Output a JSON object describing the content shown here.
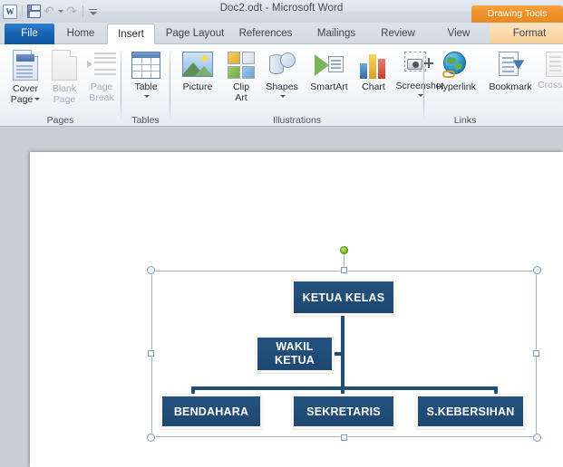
{
  "window": {
    "title": "Doc2.odt  -  Microsoft Word",
    "contextual_tab_label": "Drawing Tools"
  },
  "quick_access": {
    "items": [
      {
        "name": "word-logo-icon",
        "label": "W"
      },
      {
        "name": "save-icon",
        "label": "Save"
      },
      {
        "name": "undo-icon",
        "label": "Undo"
      },
      {
        "name": "redo-icon",
        "label": "Redo"
      },
      {
        "name": "customize-quick-access-icon",
        "label": "Customize Quick Access Toolbar"
      }
    ]
  },
  "tabs": [
    {
      "label": "File",
      "active": false,
      "kind": "file"
    },
    {
      "label": "Home",
      "active": false
    },
    {
      "label": "Insert",
      "active": true
    },
    {
      "label": "Page Layout",
      "active": false
    },
    {
      "label": "References",
      "active": false
    },
    {
      "label": "Mailings",
      "active": false
    },
    {
      "label": "Review",
      "active": false
    },
    {
      "label": "View",
      "active": false
    },
    {
      "label": "Format",
      "active": false,
      "kind": "contextual"
    }
  ],
  "ribbon": {
    "groups": [
      {
        "label": "Pages",
        "buttons": [
          {
            "label_line1": "Cover",
            "label_line2": "Page",
            "icon": "cover-page-icon",
            "dropdown": true,
            "disabled": false
          },
          {
            "label_line1": "Blank",
            "label_line2": "Page",
            "icon": "blank-page-icon",
            "dropdown": false,
            "disabled": true
          },
          {
            "label_line1": "Page",
            "label_line2": "Break",
            "icon": "page-break-icon",
            "dropdown": false,
            "disabled": true
          }
        ]
      },
      {
        "label": "Tables",
        "buttons": [
          {
            "label_line1": "Table",
            "label_line2": "",
            "icon": "table-icon",
            "dropdown": true,
            "disabled": false
          }
        ]
      },
      {
        "label": "Illustrations",
        "buttons": [
          {
            "label_line1": "Picture",
            "label_line2": "",
            "icon": "picture-icon",
            "dropdown": false,
            "disabled": false
          },
          {
            "label_line1": "Clip",
            "label_line2": "Art",
            "icon": "clip-art-icon",
            "dropdown": false,
            "disabled": false
          },
          {
            "label_line1": "Shapes",
            "label_line2": "",
            "icon": "shapes-icon",
            "dropdown": true,
            "disabled": false
          },
          {
            "label_line1": "SmartArt",
            "label_line2": "",
            "icon": "smartart-icon",
            "dropdown": false,
            "disabled": false
          },
          {
            "label_line1": "Chart",
            "label_line2": "",
            "icon": "chart-icon",
            "dropdown": false,
            "disabled": false
          },
          {
            "label_line1": "Screenshot",
            "label_line2": "",
            "icon": "screenshot-icon",
            "dropdown": true,
            "disabled": false
          }
        ]
      },
      {
        "label": "Links",
        "buttons": [
          {
            "label_line1": "Hyperlink",
            "label_line2": "",
            "icon": "hyperlink-icon",
            "dropdown": false,
            "disabled": false
          },
          {
            "label_line1": "Bookmark",
            "label_line2": "",
            "icon": "bookmark-icon",
            "dropdown": false,
            "disabled": false
          },
          {
            "label_line1": "Cross-",
            "label_line2": "",
            "icon": "cross-reference-icon",
            "dropdown": false,
            "disabled": true
          }
        ]
      }
    ]
  },
  "document": {
    "smartart": {
      "selected": true,
      "node_fill": "#1f4e79",
      "node_border": "#f7f5ee",
      "text_color": "#ffffff",
      "nodes": [
        {
          "id": "ketua-kelas",
          "label": "KETUA KELAS",
          "level": 1
        },
        {
          "id": "wakil-ketua",
          "label": "WAKIL\nKETUA",
          "label_line1": "WAKIL",
          "label_line2": "KETUA",
          "level": 2
        },
        {
          "id": "bendahara",
          "label": "BENDAHARA",
          "level": 3
        },
        {
          "id": "sekretaris",
          "label": "SEKRETARIS",
          "level": 3
        },
        {
          "id": "s-kebersihan",
          "label": "S.KEBERSIHAN",
          "level": 3
        }
      ]
    }
  }
}
